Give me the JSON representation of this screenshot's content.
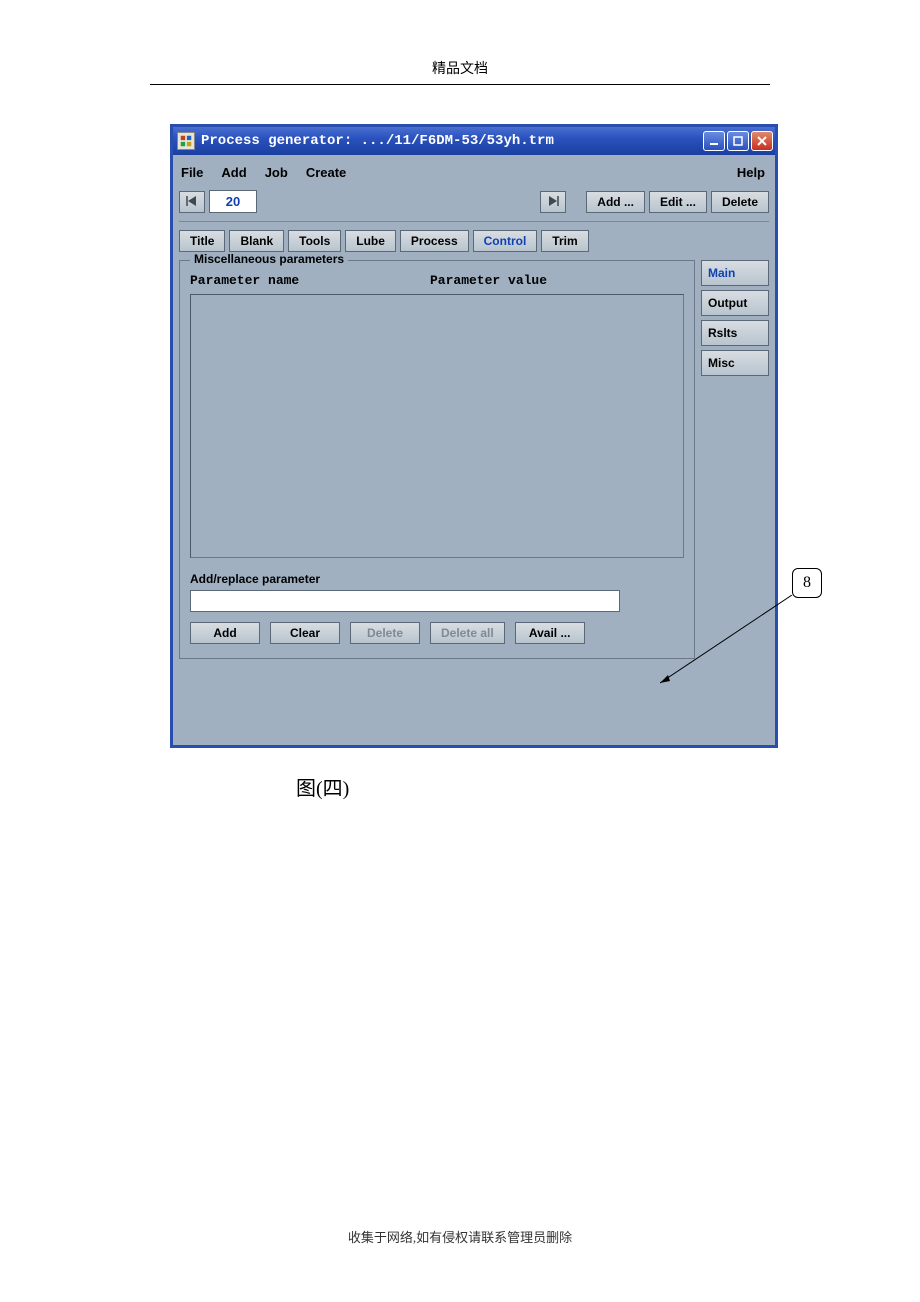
{
  "page": {
    "header": "精品文档",
    "caption": "图(四)",
    "footer": "收集于网络,如有侵权请联系管理员删除",
    "callout": "8"
  },
  "window": {
    "title": "Process generator: .../11/F6DM-53/53yh.trm"
  },
  "menubar": {
    "file": "File",
    "add": "Add",
    "job": "Job",
    "create": "Create",
    "help": "Help"
  },
  "toolbar": {
    "page_number": "20",
    "add": "Add ...",
    "edit": "Edit ...",
    "delete": "Delete"
  },
  "tabs": {
    "title": "Title",
    "blank": "Blank",
    "tools": "Tools",
    "lube": "Lube",
    "process": "Process",
    "control": "Control",
    "trim": "Trim"
  },
  "fieldset": {
    "legend": "Miscellaneous parameters",
    "col_name": "Parameter name",
    "col_value": "Parameter value",
    "addrepl_label": "Add/replace parameter",
    "addrepl_value": ""
  },
  "param_buttons": {
    "add": "Add",
    "clear": "Clear",
    "delete": "Delete",
    "delete_all": "Delete all",
    "avail": "Avail ..."
  },
  "side_tabs": {
    "main": "Main",
    "output": "Output",
    "rslts": "Rslts",
    "misc": "Misc"
  }
}
